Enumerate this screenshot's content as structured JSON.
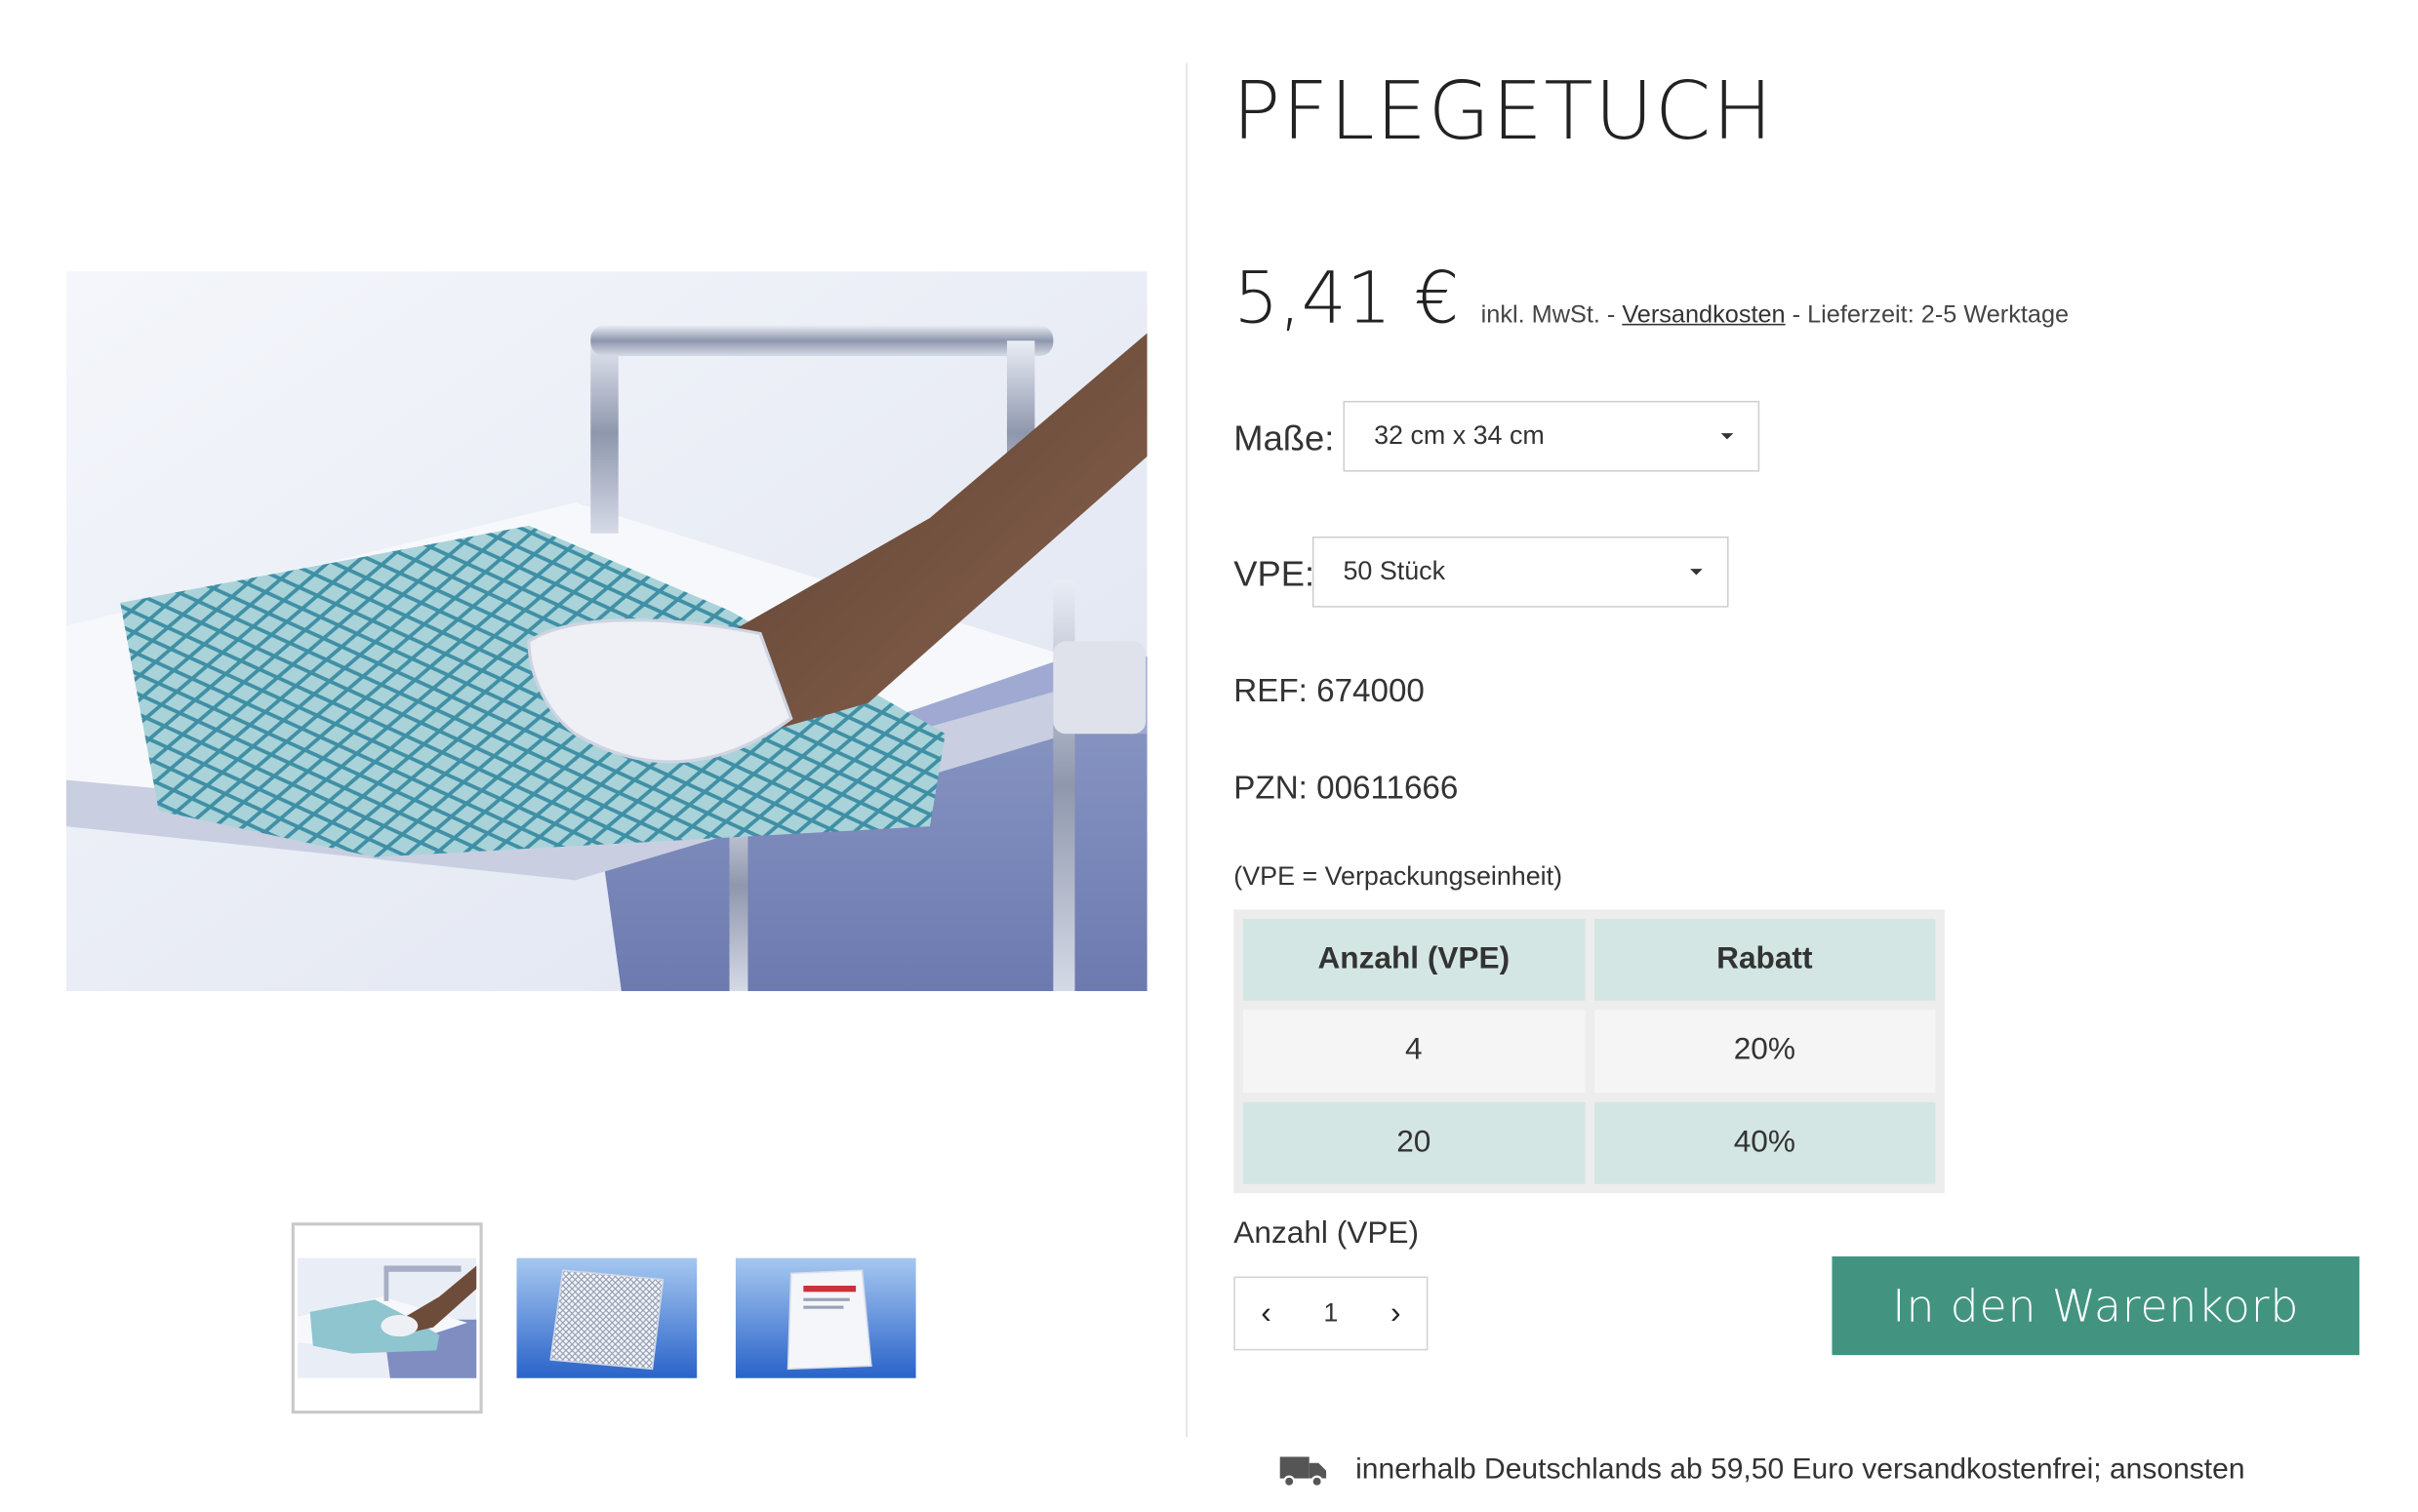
{
  "product": {
    "title": "PFLEGETUCH",
    "price": "5,41 €",
    "price_note_prefix": "inkl. MwSt. - ",
    "shipping_link": "Versandkosten",
    "price_note_suffix": " - Lieferzeit: 2-5 Werktage"
  },
  "options": {
    "size": {
      "label": "Maße:",
      "selected": "32 cm x 34 cm"
    },
    "vpe": {
      "label": "VPE:",
      "selected": "50 Stück"
    }
  },
  "details": {
    "ref_label": "REF:",
    "ref_value": "674000",
    "pzn_label": "PZN:",
    "pzn_value": "00611666",
    "vpe_note": "(VPE = Verpackungseinheit)"
  },
  "discount_table": {
    "headers": [
      "Anzahl (VPE)",
      "Rabatt"
    ],
    "rows": [
      [
        "4",
        "20%"
      ],
      [
        "20",
        "40%"
      ]
    ]
  },
  "quantity": {
    "label": "Anzahl (VPE)",
    "value": "1",
    "decrement_icon": "chevron-left-icon",
    "increment_icon": "chevron-right-icon"
  },
  "cart": {
    "button_label": "In den Warenkorb"
  },
  "shipping": {
    "icon": "truck-icon",
    "text": "innerhalb Deutschlands ab 59,50 Euro versandkostenfrei; ansonsten"
  },
  "gallery": {
    "images": [
      "product-photo-in-use",
      "product-cloth-swatch",
      "product-package"
    ],
    "active_index": 0
  },
  "colors": {
    "accent": "#429480",
    "table_teal": "#d3e6e3",
    "table_grey": "#f5f5f5",
    "cloth_blue": "#7fb9c4"
  }
}
